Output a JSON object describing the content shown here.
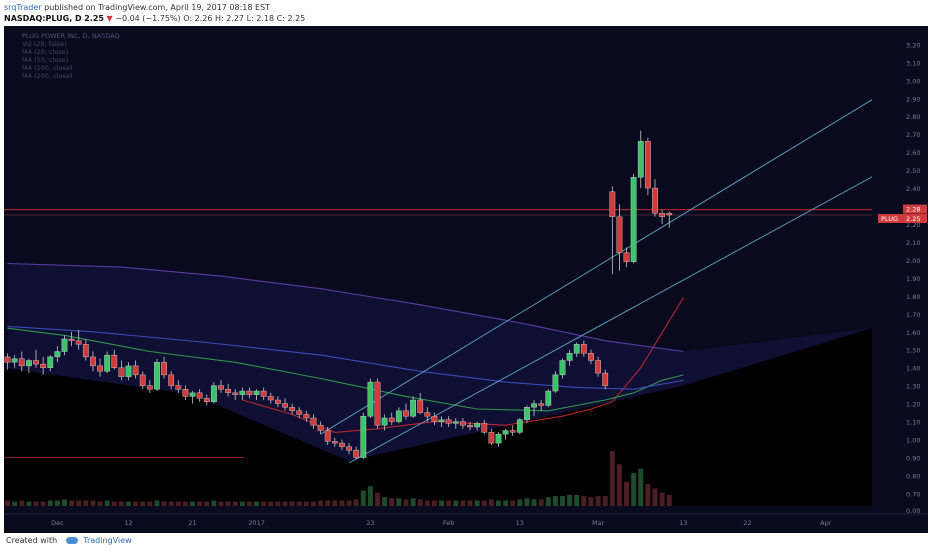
{
  "header": {
    "author": "srqTrader",
    "published_text": "published on TradingView.com, April 19, 2017 08:18 EST",
    "symbol": "NASDAQ:PLUG, D",
    "last": "2.25",
    "change_arrow": "▼",
    "change": "−0.04 (−1.75%)",
    "ohlc": "O: 2.26  H: 2.27  L: 2.18  C: 2.25"
  },
  "legend": [
    "PLUG POWER INC, D, NASDAQ",
    "Vol (20, false)",
    "MA (20, close)",
    "MA (50, close)",
    "MA (100, close)",
    "MA (200, close)"
  ],
  "footer": {
    "created_with": "Created with",
    "brand": "TradingView"
  },
  "colors": {
    "background": "#0a0a1e",
    "up": "#3cc46a",
    "down": "#d23b3b",
    "channel": "#5aa7c4",
    "ma20": "#c0272d",
    "ma50": "#2e9e4a",
    "ma100": "#3a4fbf",
    "ma200": "#5b3fa8",
    "horizontal_line": "#c0272d",
    "price_tag": "#d23b3b"
  },
  "chart_data": {
    "type": "candlestick",
    "x_labels": [
      "Dec",
      "12",
      "21",
      "2017",
      "23",
      "Feb",
      "13",
      "Mar",
      "13",
      "22",
      "Apr",
      "17",
      "May",
      "15"
    ],
    "y_ticks": [
      "0.00",
      "0.70",
      "0.80",
      "0.90",
      "1.00",
      "1.10",
      "1.20",
      "1.30",
      "1.40",
      "1.50",
      "1.60",
      "1.70",
      "1.80",
      "1.90",
      "2.00",
      "2.10",
      "2.20",
      "2.30",
      "2.40",
      "2.50",
      "2.60",
      "2.70",
      "2.80",
      "2.90",
      "3.00",
      "3.10",
      "3.20"
    ],
    "ylim": [
      0.63,
      3.28
    ],
    "price_labels": {
      "last_price": "2.25",
      "level": "2.28",
      "symbol_tag": "PLUG"
    },
    "horizontal_line": 2.28,
    "candles": [
      [
        1.46,
        1.48,
        1.39,
        1.43
      ],
      [
        1.43,
        1.47,
        1.4,
        1.45
      ],
      [
        1.45,
        1.49,
        1.38,
        1.41
      ],
      [
        1.41,
        1.45,
        1.37,
        1.44
      ],
      [
        1.44,
        1.5,
        1.4,
        1.42
      ],
      [
        1.42,
        1.46,
        1.36,
        1.4
      ],
      [
        1.4,
        1.47,
        1.38,
        1.46
      ],
      [
        1.46,
        1.52,
        1.43,
        1.49
      ],
      [
        1.49,
        1.58,
        1.47,
        1.56
      ],
      [
        1.56,
        1.6,
        1.52,
        1.55
      ],
      [
        1.55,
        1.61,
        1.5,
        1.53
      ],
      [
        1.53,
        1.56,
        1.44,
        1.46
      ],
      [
        1.46,
        1.49,
        1.38,
        1.41
      ],
      [
        1.41,
        1.45,
        1.35,
        1.38
      ],
      [
        1.38,
        1.49,
        1.37,
        1.47
      ],
      [
        1.47,
        1.5,
        1.39,
        1.4
      ],
      [
        1.4,
        1.44,
        1.33,
        1.35
      ],
      [
        1.35,
        1.43,
        1.33,
        1.41
      ],
      [
        1.41,
        1.44,
        1.34,
        1.36
      ],
      [
        1.36,
        1.38,
        1.28,
        1.3
      ],
      [
        1.3,
        1.33,
        1.26,
        1.28
      ],
      [
        1.28,
        1.45,
        1.27,
        1.43
      ],
      [
        1.43,
        1.46,
        1.34,
        1.36
      ],
      [
        1.36,
        1.38,
        1.28,
        1.3
      ],
      [
        1.3,
        1.33,
        1.26,
        1.28
      ],
      [
        1.28,
        1.3,
        1.22,
        1.24
      ],
      [
        1.24,
        1.27,
        1.2,
        1.26
      ],
      [
        1.26,
        1.28,
        1.21,
        1.23
      ],
      [
        1.23,
        1.25,
        1.19,
        1.21
      ],
      [
        1.21,
        1.32,
        1.2,
        1.3
      ],
      [
        1.3,
        1.33,
        1.26,
        1.28
      ],
      [
        1.28,
        1.31,
        1.24,
        1.26
      ],
      [
        1.26,
        1.28,
        1.22,
        1.25
      ],
      [
        1.25,
        1.29,
        1.22,
        1.27
      ],
      [
        1.27,
        1.29,
        1.23,
        1.25
      ],
      [
        1.25,
        1.28,
        1.22,
        1.27
      ],
      [
        1.27,
        1.29,
        1.22,
        1.24
      ],
      [
        1.24,
        1.26,
        1.2,
        1.22
      ],
      [
        1.22,
        1.24,
        1.18,
        1.2
      ],
      [
        1.2,
        1.23,
        1.16,
        1.18
      ],
      [
        1.18,
        1.2,
        1.14,
        1.16
      ],
      [
        1.16,
        1.18,
        1.12,
        1.14
      ],
      [
        1.14,
        1.16,
        1.1,
        1.12
      ],
      [
        1.12,
        1.14,
        1.06,
        1.08
      ],
      [
        1.08,
        1.1,
        1.03,
        1.05
      ],
      [
        1.05,
        1.07,
        0.97,
        0.99
      ],
      [
        0.99,
        1.01,
        0.96,
        0.98
      ],
      [
        0.98,
        1.0,
        0.94,
        0.96
      ],
      [
        0.96,
        0.98,
        0.92,
        0.94
      ],
      [
        0.94,
        0.96,
        0.89,
        0.9
      ],
      [
        0.9,
        1.15,
        0.89,
        1.13
      ],
      [
        1.13,
        1.34,
        1.12,
        1.32
      ],
      [
        1.32,
        1.34,
        1.06,
        1.08
      ],
      [
        1.08,
        1.14,
        1.05,
        1.12
      ],
      [
        1.12,
        1.15,
        1.08,
        1.1
      ],
      [
        1.1,
        1.18,
        1.09,
        1.16
      ],
      [
        1.16,
        1.2,
        1.11,
        1.13
      ],
      [
        1.13,
        1.24,
        1.12,
        1.22
      ],
      [
        1.22,
        1.26,
        1.14,
        1.15
      ],
      [
        1.15,
        1.18,
        1.1,
        1.13
      ],
      [
        1.13,
        1.15,
        1.08,
        1.1
      ],
      [
        1.1,
        1.13,
        1.07,
        1.11
      ],
      [
        1.11,
        1.13,
        1.07,
        1.09
      ],
      [
        1.09,
        1.12,
        1.06,
        1.1
      ],
      [
        1.1,
        1.12,
        1.06,
        1.08
      ],
      [
        1.08,
        1.1,
        1.05,
        1.07
      ],
      [
        1.07,
        1.1,
        1.05,
        1.09
      ],
      [
        1.09,
        1.11,
        1.03,
        1.04
      ],
      [
        1.04,
        1.06,
        0.97,
        0.98
      ],
      [
        0.98,
        1.04,
        0.96,
        1.03
      ],
      [
        1.03,
        1.06,
        1.0,
        1.05
      ],
      [
        1.05,
        1.08,
        1.02,
        1.04
      ],
      [
        1.04,
        1.12,
        1.03,
        1.11
      ],
      [
        1.11,
        1.19,
        1.09,
        1.18
      ],
      [
        1.18,
        1.22,
        1.13,
        1.2
      ],
      [
        1.2,
        1.22,
        1.16,
        1.19
      ],
      [
        1.19,
        1.28,
        1.18,
        1.27
      ],
      [
        1.27,
        1.38,
        1.26,
        1.36
      ],
      [
        1.36,
        1.45,
        1.34,
        1.44
      ],
      [
        1.44,
        1.5,
        1.41,
        1.48
      ],
      [
        1.48,
        1.54,
        1.46,
        1.53
      ],
      [
        1.53,
        1.55,
        1.46,
        1.48
      ],
      [
        1.48,
        1.5,
        1.42,
        1.44
      ],
      [
        1.44,
        1.46,
        1.35,
        1.37
      ],
      [
        1.37,
        1.39,
        1.28,
        1.3
      ],
      [
        2.38,
        2.41,
        1.92,
        2.24
      ],
      [
        2.24,
        2.31,
        1.94,
        2.04
      ],
      [
        2.04,
        2.07,
        1.96,
        1.99
      ],
      [
        1.99,
        2.48,
        1.98,
        2.46
      ],
      [
        2.46,
        2.72,
        2.4,
        2.66
      ],
      [
        2.66,
        2.68,
        2.36,
        2.4
      ],
      [
        2.4,
        2.45,
        2.24,
        2.26
      ],
      [
        2.26,
        2.28,
        2.2,
        2.24
      ],
      [
        2.26,
        2.27,
        2.18,
        2.25
      ]
    ],
    "x_axis_slot_count": 122,
    "volume": [
      0.05,
      0.04,
      0.05,
      0.04,
      0.04,
      0.04,
      0.05,
      0.05,
      0.06,
      0.05,
      0.05,
      0.05,
      0.05,
      0.04,
      0.05,
      0.04,
      0.04,
      0.04,
      0.04,
      0.04,
      0.04,
      0.05,
      0.04,
      0.04,
      0.04,
      0.04,
      0.04,
      0.04,
      0.04,
      0.05,
      0.04,
      0.04,
      0.04,
      0.04,
      0.04,
      0.04,
      0.04,
      0.04,
      0.04,
      0.04,
      0.04,
      0.04,
      0.04,
      0.04,
      0.05,
      0.05,
      0.05,
      0.05,
      0.05,
      0.06,
      0.14,
      0.18,
      0.12,
      0.08,
      0.07,
      0.07,
      0.06,
      0.07,
      0.06,
      0.05,
      0.05,
      0.05,
      0.05,
      0.05,
      0.05,
      0.05,
      0.05,
      0.05,
      0.06,
      0.05,
      0.05,
      0.05,
      0.06,
      0.07,
      0.06,
      0.06,
      0.08,
      0.09,
      0.09,
      0.1,
      0.1,
      0.09,
      0.08,
      0.09,
      0.09,
      0.5,
      0.38,
      0.22,
      0.3,
      0.34,
      0.2,
      0.16,
      0.12,
      0.1
    ],
    "channel_lines": [
      {
        "from": [
          44,
          1.03
        ],
        "to": [
          126,
          3.0
        ]
      },
      {
        "from": [
          48,
          0.87
        ],
        "to": [
          132,
          2.69
        ]
      }
    ],
    "series": [
      {
        "name": "MA (20, close)",
        "values": [
          [
            33,
            1.22
          ],
          [
            40,
            1.14
          ],
          [
            46,
            1.04
          ],
          [
            52,
            1.06
          ],
          [
            60,
            1.1
          ],
          [
            70,
            1.08
          ],
          [
            78,
            1.13
          ],
          [
            82,
            1.17
          ],
          [
            85,
            1.21
          ],
          [
            89,
            1.4
          ],
          [
            93,
            1.66
          ],
          [
            95,
            1.79
          ]
        ]
      },
      {
        "name": "MA (50, close)",
        "values": [
          [
            0,
            1.62
          ],
          [
            8,
            1.58
          ],
          [
            20,
            1.49
          ],
          [
            32,
            1.43
          ],
          [
            44,
            1.34
          ],
          [
            56,
            1.24
          ],
          [
            66,
            1.17
          ],
          [
            76,
            1.16
          ],
          [
            84,
            1.22
          ],
          [
            88,
            1.26
          ],
          [
            92,
            1.33
          ],
          [
            95,
            1.36
          ]
        ]
      },
      {
        "name": "MA (100, close)",
        "values": [
          [
            0,
            1.63
          ],
          [
            12,
            1.6
          ],
          [
            28,
            1.54
          ],
          [
            44,
            1.47
          ],
          [
            58,
            1.38
          ],
          [
            70,
            1.32
          ],
          [
            80,
            1.29
          ],
          [
            88,
            1.28
          ],
          [
            95,
            1.33
          ]
        ]
      },
      {
        "name": "MA (200, close)",
        "values": [
          [
            0,
            1.98
          ],
          [
            16,
            1.96
          ],
          [
            30,
            1.91
          ],
          [
            44,
            1.84
          ],
          [
            58,
            1.75
          ],
          [
            72,
            1.65
          ],
          [
            84,
            1.55
          ],
          [
            95,
            1.49
          ]
        ]
      }
    ],
    "x_label_slots": [
      7,
      17,
      26,
      35,
      51,
      62,
      72,
      83,
      95,
      104,
      115,
      126,
      136,
      145
    ]
  }
}
